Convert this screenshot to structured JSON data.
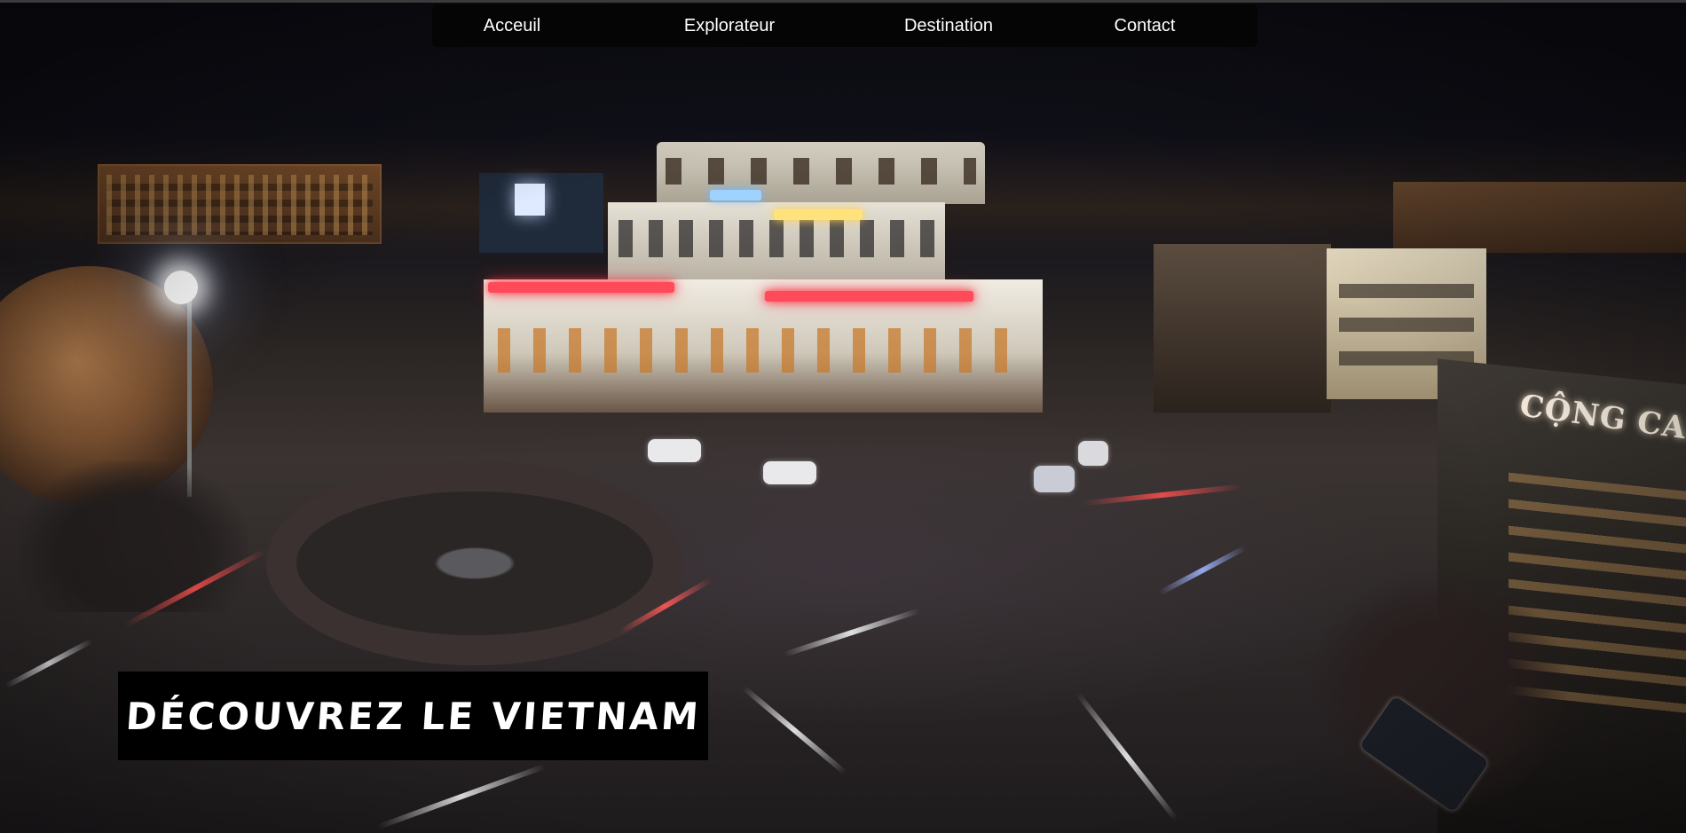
{
  "nav": {
    "items": [
      {
        "label": "Acceuil"
      },
      {
        "label": "Explorateur"
      },
      {
        "label": "Destination"
      },
      {
        "label": "Contact"
      }
    ]
  },
  "hero": {
    "title": "DÉCOUVREZ LE VIETNAM",
    "background_image": "night-roundabout-hanoi-photo"
  },
  "scene_signs": {
    "cong_cafe": "CỘNG CAF"
  },
  "colors": {
    "nav_bg": "#050505",
    "nav_text": "#ffffff",
    "hero_box_bg": "#000000",
    "hero_text": "#ffffff"
  }
}
